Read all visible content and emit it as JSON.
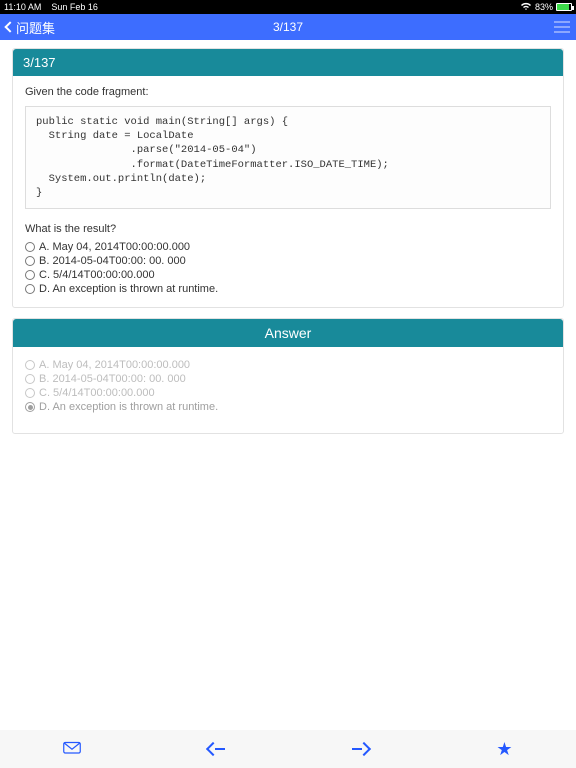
{
  "status": {
    "time": "11:10 AM",
    "date": "Sun Feb 16",
    "battery_pct": "83%"
  },
  "nav": {
    "back_label": "问题集",
    "title": "3/137"
  },
  "question": {
    "header": "3/137",
    "intro": "Given the code fragment:",
    "code": "public static void main(String[] args) {\n  String date = LocalDate\n               .parse(\"2014-05-04\")\n               .format(DateTimeFormatter.ISO_DATE_TIME);\n  System.out.println(date);\n}",
    "prompt": "What is the result?",
    "options": [
      "A. May 04, 2014T00:00:00.000",
      "B. 2014-05-04T00:00: 00. 000",
      "C. 5/4/14T00:00:00.000",
      "D. An exception is thrown at runtime."
    ]
  },
  "answer": {
    "header": "Answer",
    "options": [
      "A. May 04, 2014T00:00:00.000",
      "B. 2014-05-04T00:00: 00. 000",
      "C. 5/4/14T00:00:00.000",
      "D. An exception is thrown at runtime."
    ],
    "correct_index": 3
  }
}
